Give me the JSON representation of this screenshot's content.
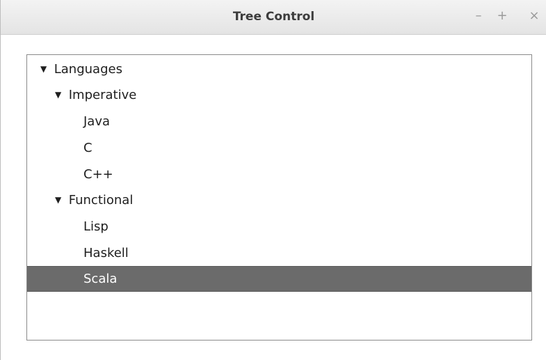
{
  "window": {
    "title": "Tree Control",
    "minimize_glyph": "–",
    "maximize_glyph": "+",
    "close_glyph": "×"
  },
  "tree": {
    "expanded_arrow_glyph": "▼",
    "selected_item": "Scala",
    "colors": {
      "selection_background": "#6b6b6b",
      "selection_text": "#ffffff"
    },
    "nodes": [
      {
        "label": "Languages",
        "level": 0,
        "expandable": true,
        "expanded": true
      },
      {
        "label": "Imperative",
        "level": 1,
        "expandable": true,
        "expanded": true
      },
      {
        "label": "Java",
        "level": 2,
        "expandable": false
      },
      {
        "label": "C",
        "level": 2,
        "expandable": false
      },
      {
        "label": "C++",
        "level": 2,
        "expandable": false
      },
      {
        "label": "Functional",
        "level": 1,
        "expandable": true,
        "expanded": true
      },
      {
        "label": "Lisp",
        "level": 2,
        "expandable": false
      },
      {
        "label": "Haskell",
        "level": 2,
        "expandable": false
      },
      {
        "label": "Scala",
        "level": 2,
        "expandable": false,
        "selected": true
      }
    ]
  }
}
